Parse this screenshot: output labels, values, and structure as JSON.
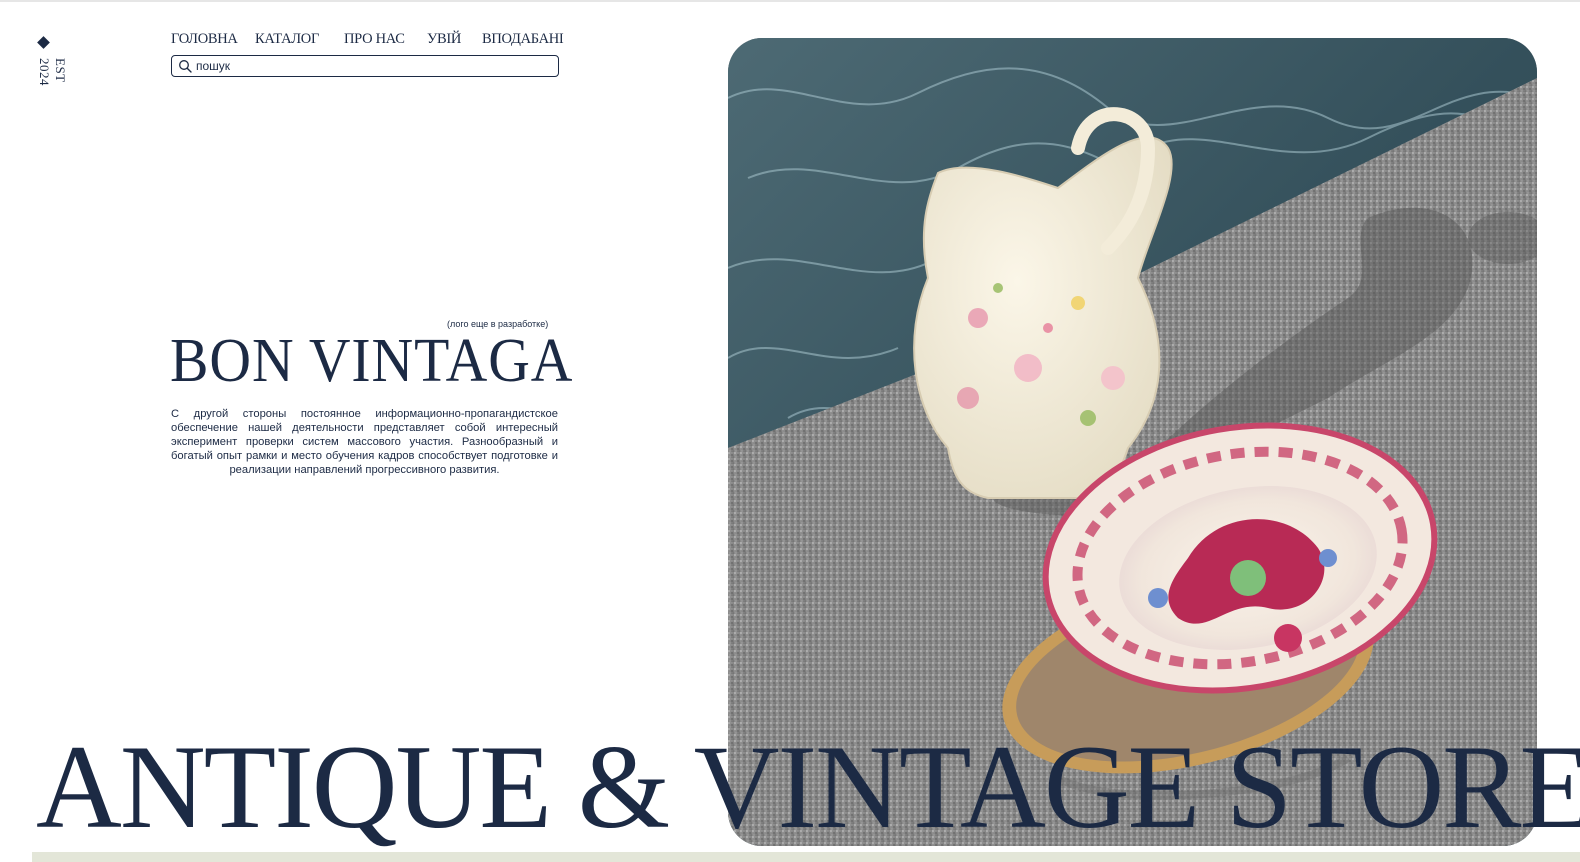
{
  "side": {
    "est_label": "EST 2024",
    "mark_icon": "diamond-icon"
  },
  "nav": {
    "items": [
      {
        "label": "ГОЛОВНА"
      },
      {
        "label": "КАТАЛОГ"
      },
      {
        "label": "ПРО НАС"
      },
      {
        "label": "УВІЙ"
      },
      {
        "label": "ВПОДАБАНІ"
      }
    ]
  },
  "search": {
    "placeholder": "пошук",
    "icon": "search-icon"
  },
  "hero": {
    "logo_note": "(лого еще в разработке)",
    "brand_name": "BON VINTAGA",
    "description": "С другой стороны постоянное информационно-пропагандистское обеспечение нашей деятельности представляет собой интересный эксперимент проверки систем массового участия. Разнообразный и богатый опыт рамки и место обучения кадров способствует подготовке и реализации направлений прогрессивного развития.",
    "headline": "ANTIQUE & VINTAGE STORE"
  },
  "colors": {
    "text": "#1c2a44",
    "background": "#ffffff",
    "water": "#3f5a66",
    "stone": "#8b8b8b"
  }
}
